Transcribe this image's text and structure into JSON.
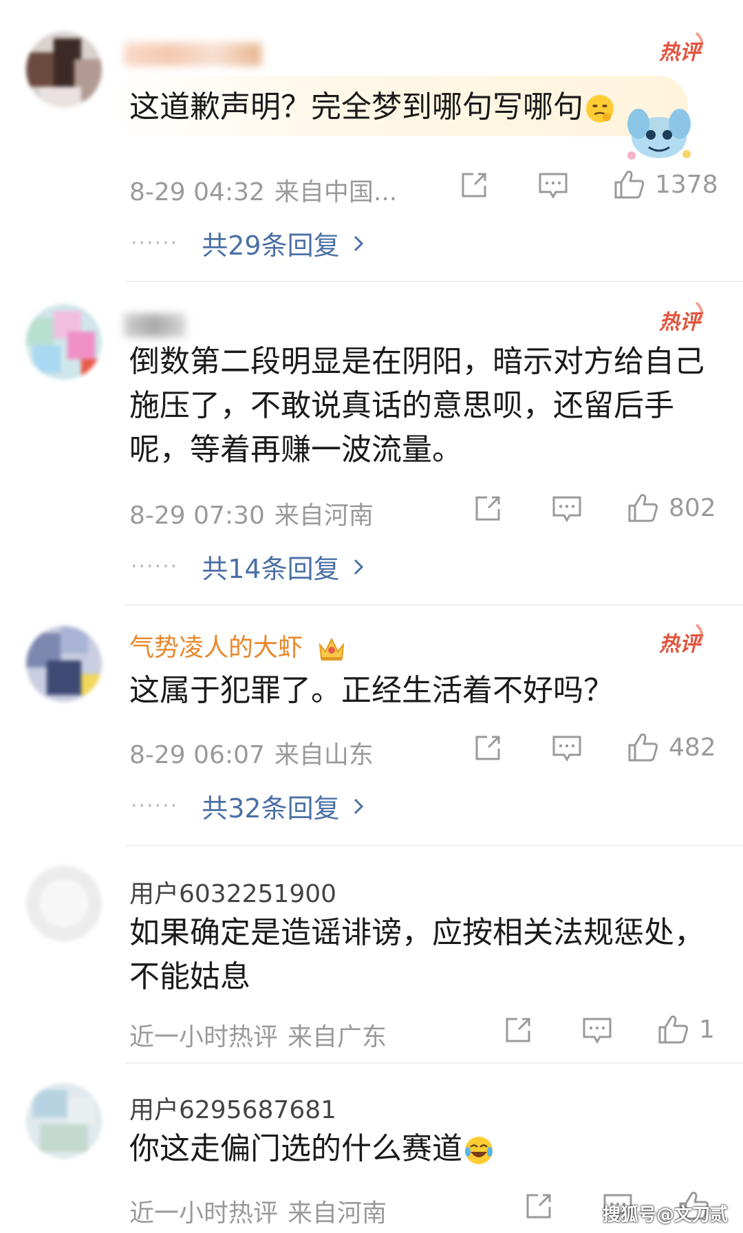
{
  "hot_badge": "热评",
  "comments": [
    {
      "text": "这道歉声明？完全梦到哪句写哪句",
      "time": "8-29 04:32",
      "location": "来自中国...",
      "likes": "1378",
      "replies": "共29条回复"
    },
    {
      "text": "倒数第二段明显是在阴阳，暗示对方给自己施压了，不敢说真话的意思呗，还留后手呢，等着再赚一波流量。",
      "time": "8-29 07:30",
      "location": "来自河南",
      "likes": "802",
      "replies": "共14条回复"
    },
    {
      "name": "气势凌人的大虾",
      "text": "这属于犯罪了。正经生活着不好吗？",
      "time": "8-29 06:07",
      "location": "来自山东",
      "likes": "482",
      "replies": "共32条回复"
    },
    {
      "name": "用户6032251900",
      "text": "如果确定是造谣诽谤，应按相关法规惩处，不能姑息",
      "time": "近一小时热评",
      "location": "来自广东",
      "likes": "1"
    },
    {
      "name": "用户6295687681",
      "text": "你这走偏门选的什么赛道",
      "time": "近一小时热评",
      "location": "来自河南"
    }
  ],
  "reply_dots": "······",
  "watermark": "搜狐号@文刀贰",
  "colors": {
    "reply_link": "#4a6fa5",
    "vip_name": "#e8872a",
    "hot_badge": "#e0533c",
    "meta_gray": "#9a9a9a"
  },
  "icons": [
    "share-icon",
    "comment-icon",
    "like-icon",
    "chevron-right-icon",
    "crown-icon",
    "hot-badge-icon"
  ]
}
